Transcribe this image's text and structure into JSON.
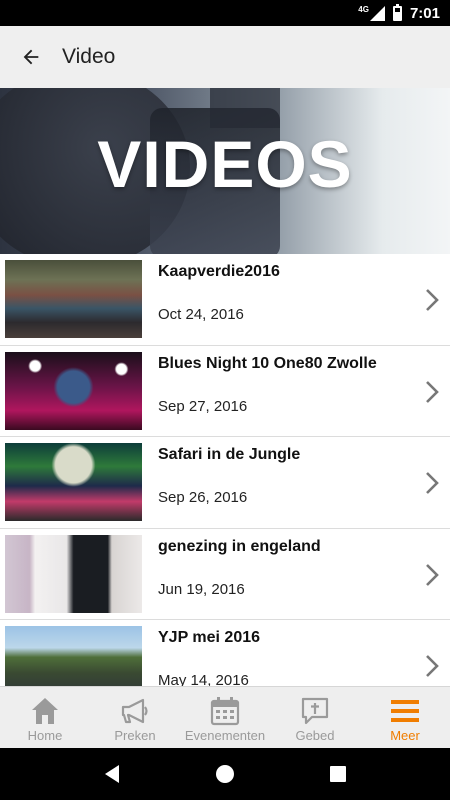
{
  "status_bar": {
    "network": "4G",
    "time": "7:01"
  },
  "toolbar": {
    "title": "Video"
  },
  "banner": {
    "title": "VIDEOS"
  },
  "videos": [
    {
      "title": "Kaapverdie2016",
      "date": "Oct 24, 2016"
    },
    {
      "title": "Blues Night 10 One80 Zwolle",
      "date": "Sep 27, 2016"
    },
    {
      "title": "Safari in de Jungle",
      "date": "Sep 26, 2016"
    },
    {
      "title": "genezing in engeland",
      "date": "Jun 19, 2016"
    },
    {
      "title": "YJP mei 2016",
      "date": "May 14, 2016"
    }
  ],
  "bottom_nav": [
    {
      "label": "Home",
      "icon": "home-icon",
      "active": false
    },
    {
      "label": "Preken",
      "icon": "megaphone-icon",
      "active": false
    },
    {
      "label": "Evenementen",
      "icon": "calendar-icon",
      "active": false
    },
    {
      "label": "Gebed",
      "icon": "prayer-bubble-icon",
      "active": false
    },
    {
      "label": "Meer",
      "icon": "menu-icon",
      "active": true
    }
  ],
  "colors": {
    "accent": "#f07d00",
    "inactive": "#9a9a9a",
    "toolbar_bg": "#efefef"
  }
}
